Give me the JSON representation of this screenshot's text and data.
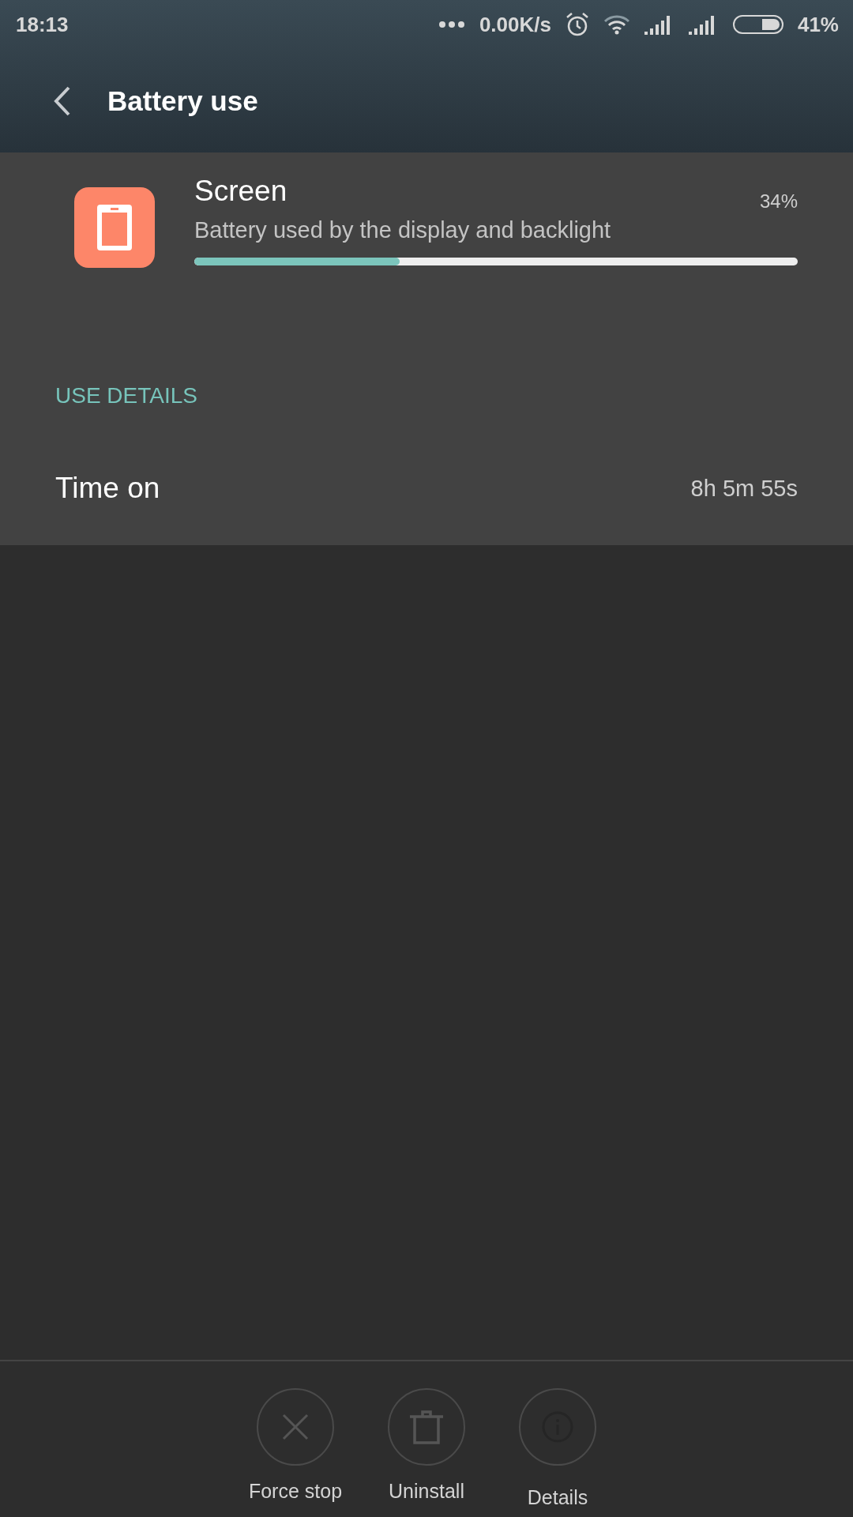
{
  "status_bar": {
    "time": "18:13",
    "network_speed": "0.00K/s",
    "battery_percent": "41%"
  },
  "header": {
    "title": "Battery use"
  },
  "app": {
    "name": "Screen",
    "description": "Battery used by the display and backlight",
    "percent": "34%",
    "level": 0.34
  },
  "section": {
    "heading": "USE DETAILS",
    "rows": [
      {
        "label": "Time on",
        "value": "8h 5m 55s"
      }
    ]
  },
  "actions": [
    {
      "kind": "close",
      "label": "Force stop"
    },
    {
      "kind": "trash",
      "label": "Uninstall"
    },
    {
      "kind": "info",
      "label": "Details"
    }
  ]
}
